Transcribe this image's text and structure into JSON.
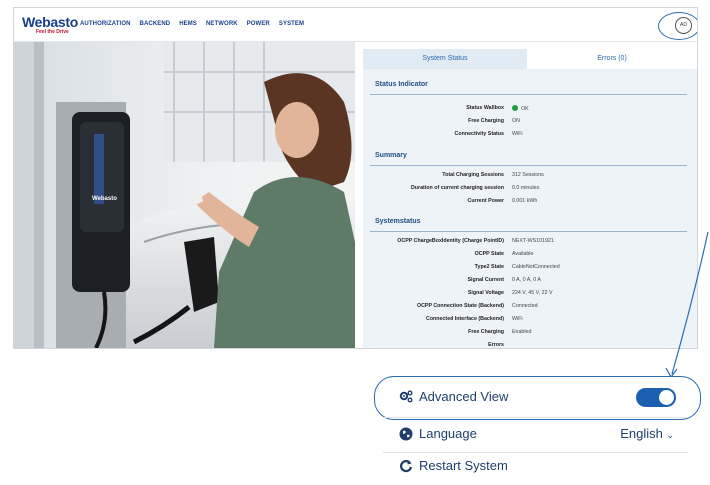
{
  "brand": {
    "name": "Webasto",
    "tagline": "Feel the Drive"
  },
  "nav": [
    "AUTHORIZATION",
    "BACKEND",
    "HEMS",
    "NETWORK",
    "POWER",
    "SYSTEM"
  ],
  "user": {
    "initials": "AD"
  },
  "tabs": {
    "system_status": "System Status",
    "errors": "Errors (0)"
  },
  "status_indicator": {
    "title": "Status Indicator",
    "rows": [
      {
        "label": "Status Wallbox",
        "value": "OK"
      },
      {
        "label": "Free Charging",
        "value": "ON"
      },
      {
        "label": "Connectivity Status",
        "value": "WiFi"
      }
    ]
  },
  "summary": {
    "title": "Summary",
    "rows": [
      {
        "label": "Total Charging Sessions",
        "value": "312 Sessions"
      },
      {
        "label": "Duration of current charging session",
        "value": "0.0 minutes"
      },
      {
        "label": "Current Power",
        "value": "0.001 kWh"
      }
    ]
  },
  "systemstatus": {
    "title": "Systemstatus",
    "rows": [
      {
        "label": "OCPP ChargeBoxIdentity (Charge PointID)",
        "value": "NEXT-WS101921"
      },
      {
        "label": "OCPP State",
        "value": "Available"
      },
      {
        "label": "Type2 State",
        "value": "CableNotConnected"
      },
      {
        "label": "Signal Current",
        "value": "0 A, 0 A, 0 A"
      },
      {
        "label": "Signal Voltage",
        "value": "224 V, 45 V, 22 V"
      },
      {
        "label": "OCPP Connection State (Backend)",
        "value": "Connected"
      },
      {
        "label": "Connected Interface (Backend)",
        "value": "WiFi"
      },
      {
        "label": "Free Charging",
        "value": "Enabled"
      },
      {
        "label": "Errors",
        "value": ""
      }
    ]
  },
  "menu": {
    "advanced_view": {
      "label": "Advanced View",
      "enabled": true,
      "icon": "gears-icon"
    },
    "language": {
      "label": "Language",
      "value": "English",
      "icon": "globe-icon"
    },
    "restart": {
      "label": "Restart System",
      "icon": "restart-icon"
    }
  },
  "colors": {
    "brand_blue": "#17418c",
    "accent_blue": "#1a5fb0",
    "ok_green": "#1f9d3a"
  }
}
